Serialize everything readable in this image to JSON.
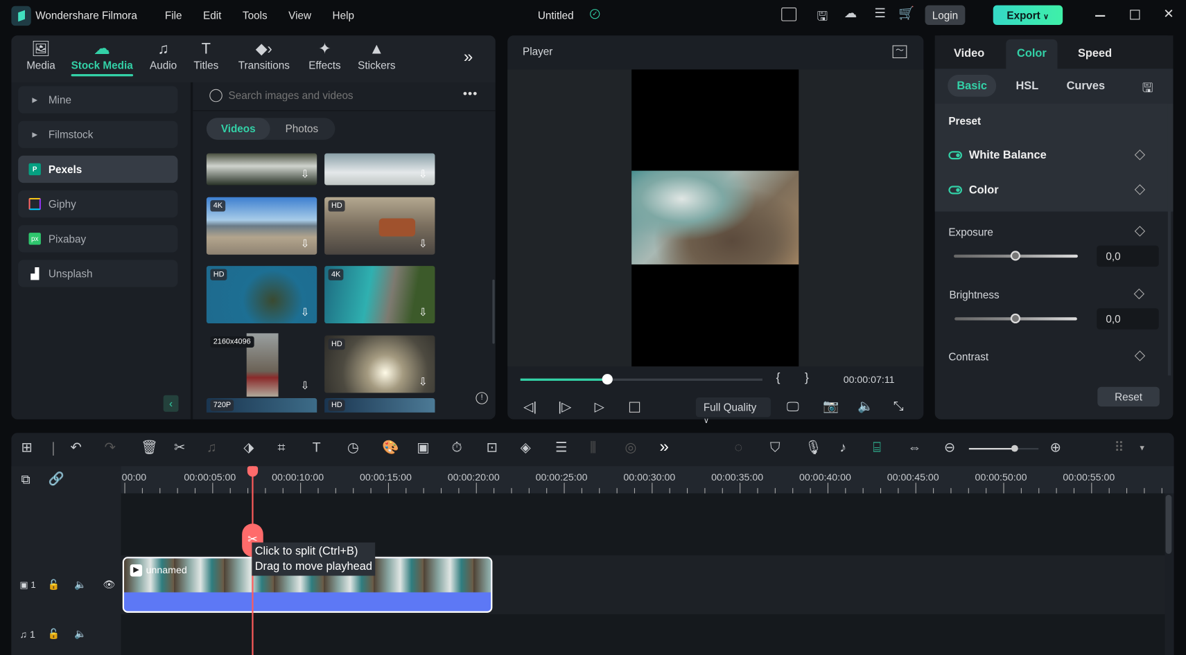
{
  "app": {
    "name": "Wondershare Filmora",
    "project_title": "Untitled",
    "menu": [
      "File",
      "Edit",
      "Tools",
      "View",
      "Help"
    ],
    "login_label": "Login",
    "export_label": "Export",
    "accent": "#33d1a7"
  },
  "media_tabs": [
    {
      "label": "Media",
      "icon": "media-icon"
    },
    {
      "label": "Stock Media",
      "icon": "stock-media-icon",
      "active": true
    },
    {
      "label": "Audio",
      "icon": "music-note-icon"
    },
    {
      "label": "Titles",
      "icon": "text-icon"
    },
    {
      "label": "Transitions",
      "icon": "transitions-icon"
    },
    {
      "label": "Effects",
      "icon": "effects-icon"
    },
    {
      "label": "Stickers",
      "icon": "stickers-icon"
    }
  ],
  "sidebar": {
    "items": [
      {
        "label": "Mine"
      },
      {
        "label": "Filmstock"
      },
      {
        "label": "Pexels",
        "active": true
      },
      {
        "label": "Giphy"
      },
      {
        "label": "Pixabay"
      },
      {
        "label": "Unsplash"
      }
    ]
  },
  "search": {
    "placeholder": "Search images and videos"
  },
  "filter_tabs": {
    "videos": "Videos",
    "photos": "Photos",
    "active": "Videos"
  },
  "thumbnails": [
    {
      "badge": ""
    },
    {
      "badge": ""
    },
    {
      "badge": "4K"
    },
    {
      "badge": "HD"
    },
    {
      "badge": "HD"
    },
    {
      "badge": "4K"
    },
    {
      "badge": "2160x4096"
    },
    {
      "badge": "HD"
    },
    {
      "badge": "720P"
    },
    {
      "badge": "HD"
    }
  ],
  "player": {
    "title": "Player",
    "timecode": "00:00:07:11",
    "progress": 0.36,
    "quality": "Full Quality",
    "mark_in": "{",
    "mark_out": "}"
  },
  "properties": {
    "tabs": [
      "Video",
      "Color",
      "Speed"
    ],
    "active_tab": "Color",
    "subtabs": [
      "Basic",
      "HSL",
      "Curves"
    ],
    "active_subtab": "Basic",
    "preset_label": "Preset",
    "toggles": [
      {
        "label": "White Balance",
        "on": true
      },
      {
        "label": "Color",
        "on": true
      }
    ],
    "sliders": [
      {
        "label": "Exposure",
        "value": "0,0",
        "level": 0.5
      },
      {
        "label": "Brightness",
        "value": "0,0",
        "level": 0.5
      },
      {
        "label": "Contrast"
      }
    ],
    "reset_label": "Reset"
  },
  "timeline": {
    "ruler": [
      "00:00",
      "00:00:05:00",
      "00:00:10:00",
      "00:00:15:00",
      "00:00:20:00",
      "00:00:25:00",
      "00:00:30:00",
      "00:00:35:00",
      "00:00:40:00",
      "00:00:45:00",
      "00:00:50:00",
      "00:00:55:00"
    ],
    "zoom_level": 0.65,
    "video_track": {
      "number": "1",
      "clip_name": "unnamed"
    },
    "audio_track": {
      "number": "1"
    },
    "tooltip": {
      "line1": "Click to split (Ctrl+B)",
      "line2": "Drag to move playhead"
    }
  }
}
